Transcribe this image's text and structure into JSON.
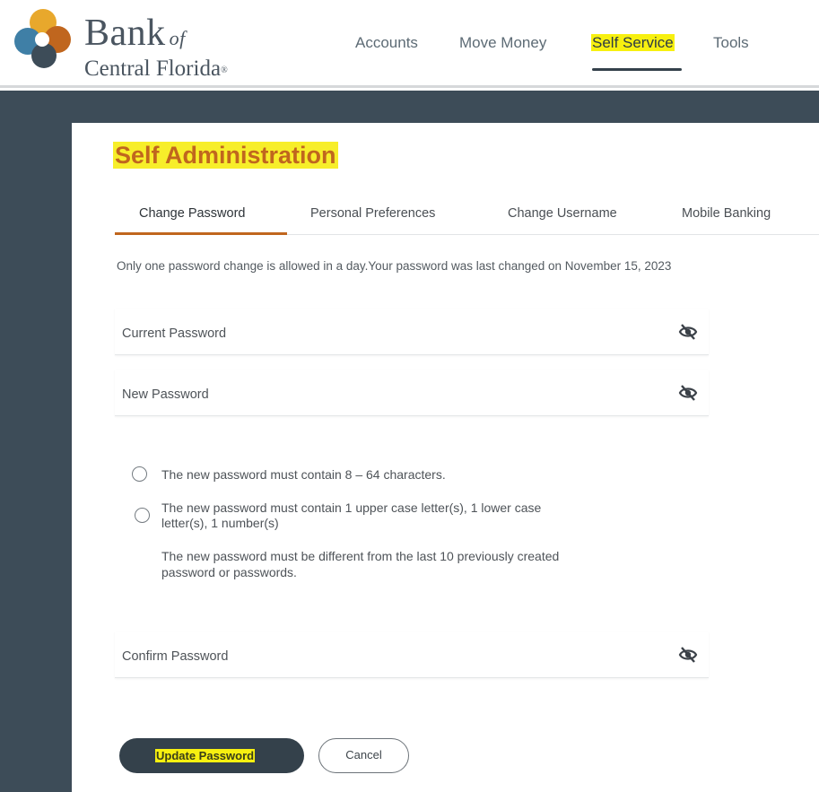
{
  "brand": {
    "line1": "Bank",
    "of": "of",
    "line2": "Central Florida",
    "mark": "®",
    "logo_colors": [
      "#e8a82c",
      "#c0661e",
      "#3f7fa6",
      "#3d4c58"
    ]
  },
  "nav": {
    "items": [
      {
        "label": "Accounts",
        "active": false
      },
      {
        "label": "Move Money",
        "active": false
      },
      {
        "label": "Self Service",
        "active": true
      },
      {
        "label": "Tools",
        "active": false
      }
    ]
  },
  "page": {
    "title": "Self Administration",
    "tabs": [
      {
        "label": "Change Password",
        "active": true
      },
      {
        "label": "Personal Preferences",
        "active": false
      },
      {
        "label": "Change Username",
        "active": false
      },
      {
        "label": "Mobile Banking",
        "active": false
      }
    ],
    "notice": "Only one password change is allowed in a day.Your password was last changed on November 15, 2023"
  },
  "form": {
    "current_password_label": "Current Password",
    "new_password_label": "New Password",
    "confirm_password_label": "Confirm Password",
    "eye_icon": "eye-slash-icon"
  },
  "rules": {
    "rule1": "The new password must contain 8 – 64 characters.",
    "rule2_line1": "The new password must contain 1 upper case letter(s), 1 lower case",
    "rule2_line2": "letter(s), 1 number(s)",
    "rule3_line1": "The new password must be different from the last 10 previously created",
    "rule3_line2": "password or passwords."
  },
  "buttons": {
    "update_label": "Update Password",
    "cancel_label": "Cancel"
  },
  "colors": {
    "accent_orange": "#c0661e",
    "dark_slate": "#3d4c58",
    "highlight_yellow": "#f7f010"
  }
}
